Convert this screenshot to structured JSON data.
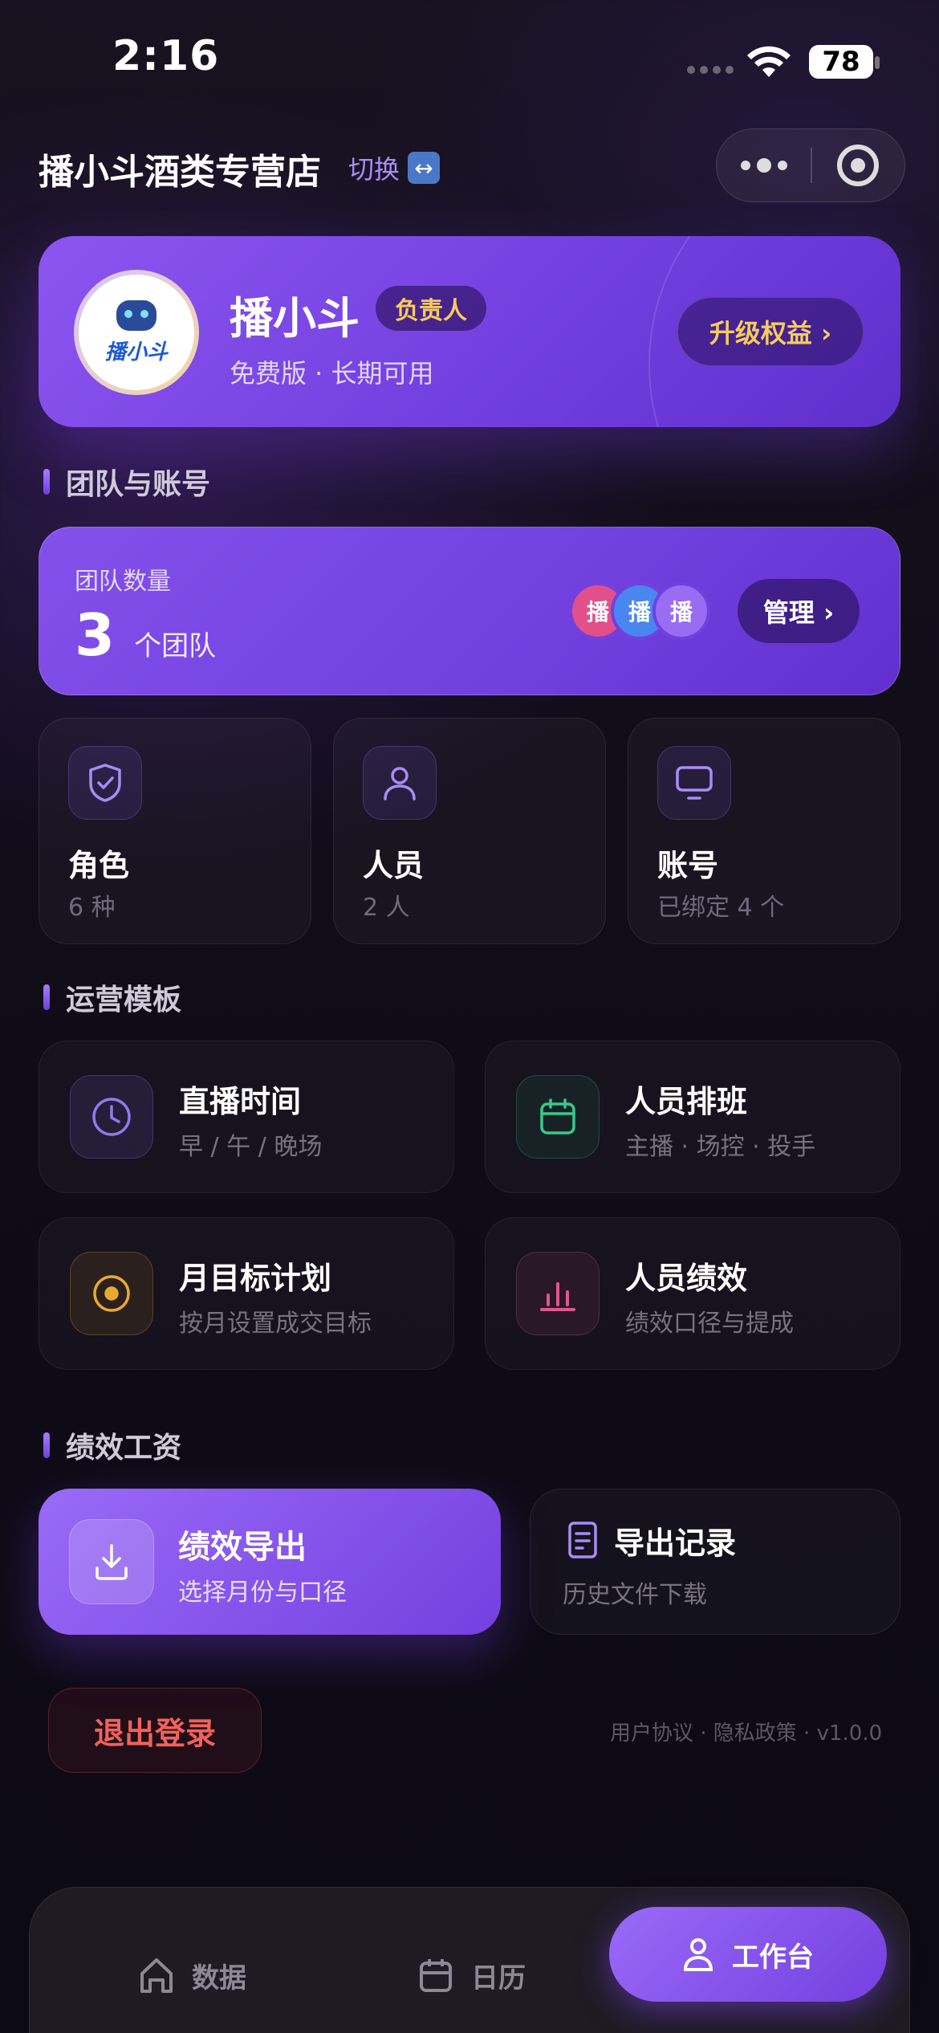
{
  "status_bar": {
    "time": "2:16",
    "battery": "78"
  },
  "header": {
    "store_name": "播小斗酒类专营店",
    "switch_label": "切换",
    "switch_icon": "↔"
  },
  "profile": {
    "avatar_text": "播小斗",
    "name": "播小斗",
    "role_badge": "负责人",
    "plan": "免费版 · 长期可用",
    "upgrade_label": "升级权益 ›"
  },
  "team_section": {
    "title": "团队与账号",
    "team_label": "团队数量",
    "team_count": "3",
    "team_unit": "个团队",
    "bubbles": [
      {
        "text": "播",
        "color": "#e2508c"
      },
      {
        "text": "播",
        "color": "#4a86f0"
      },
      {
        "text": "播",
        "color": "#9a6cf2"
      }
    ],
    "manage_label": "管理 ›",
    "cards": [
      {
        "title": "角色",
        "sub": "6 种",
        "icon": "shield-check-icon"
      },
      {
        "title": "人员",
        "sub": "2 人",
        "icon": "person-icon"
      },
      {
        "title": "账号",
        "sub": "已绑定 4 个",
        "icon": "monitor-icon"
      }
    ]
  },
  "templates_section": {
    "title": "运营模板",
    "items": [
      {
        "title": "直播时间",
        "sub": "早 / 午 / 晚场",
        "icon": "clock-icon",
        "color": "#8f7bea"
      },
      {
        "title": "人员排班",
        "sub": "主播 · 场控 · 投手",
        "icon": "calendar-icon",
        "color": "#39c98b"
      },
      {
        "title": "月目标计划",
        "sub": "按月设置成交目标",
        "icon": "target-icon",
        "color": "#e9a92c"
      },
      {
        "title": "人员绩效",
        "sub": "绩效口径与提成",
        "icon": "bar-chart-icon",
        "color": "#e0568e"
      }
    ]
  },
  "salary_section": {
    "title": "绩效工资",
    "export_title": "绩效导出",
    "export_sub": "选择月份与口径",
    "records_title": "导出记录",
    "records_sub": "历史文件下载"
  },
  "logout_label": "退出登录",
  "footer": "用户协议 · 隐私政策 · v1.0.0",
  "tabbar": [
    {
      "label": "数据",
      "icon": "home-icon"
    },
    {
      "label": "日历",
      "icon": "calendar-icon"
    },
    {
      "label": "工作台",
      "icon": "user-icon"
    }
  ],
  "colors": {
    "accent": "#7d4ae6",
    "gold": "#f6cc5c",
    "danger": "#f0625b"
  }
}
